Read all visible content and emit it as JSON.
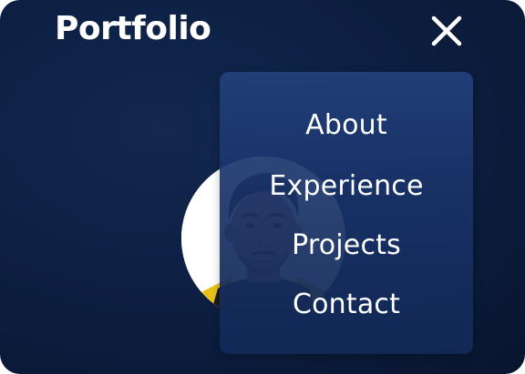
{
  "header": {
    "logo_text": "Portfolio",
    "close_icon": "close-icon"
  },
  "profile": {
    "avatar_icon": "profile-photo"
  },
  "menu": {
    "items": [
      {
        "label": "About"
      },
      {
        "label": "Experience"
      },
      {
        "label": "Projects"
      },
      {
        "label": "Contact"
      }
    ]
  },
  "colors": {
    "background": "#0d1f43",
    "menu_panel": "#1c3a74",
    "text": "#ffffff",
    "accent_shirt": "#e8c21a"
  }
}
